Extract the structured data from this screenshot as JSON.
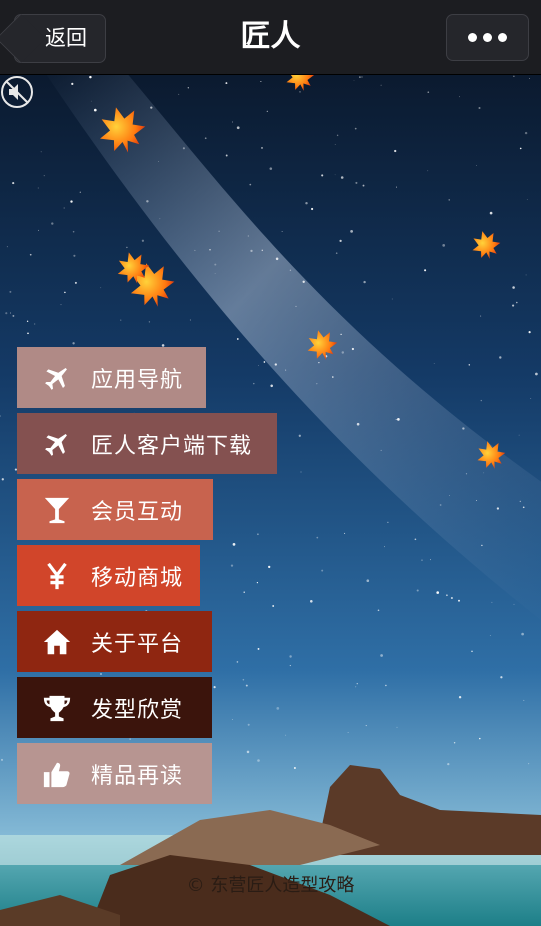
{
  "header": {
    "back_label": "返回",
    "title": "匠人"
  },
  "menu": [
    {
      "label": "应用导航",
      "icon": "airplane-icon",
      "color": "#b08a86"
    },
    {
      "label": "匠人客户端下载",
      "icon": "airplane-icon",
      "color": "#845150"
    },
    {
      "label": "会员互动",
      "icon": "cocktail-glass-icon",
      "color": "#c8634e"
    },
    {
      "label": "移动商城",
      "icon": "yen-icon",
      "color": "#d1452a"
    },
    {
      "label": "关于平台",
      "icon": "home-icon",
      "color": "#8f2611"
    },
    {
      "label": "发型欣赏",
      "icon": "trophy-icon",
      "color": "#3b140c"
    },
    {
      "label": "精品再读",
      "icon": "thumbs-up-icon",
      "color": "#b79591"
    }
  ],
  "footer": {
    "text": "© 东营匠人造型攻略"
  }
}
